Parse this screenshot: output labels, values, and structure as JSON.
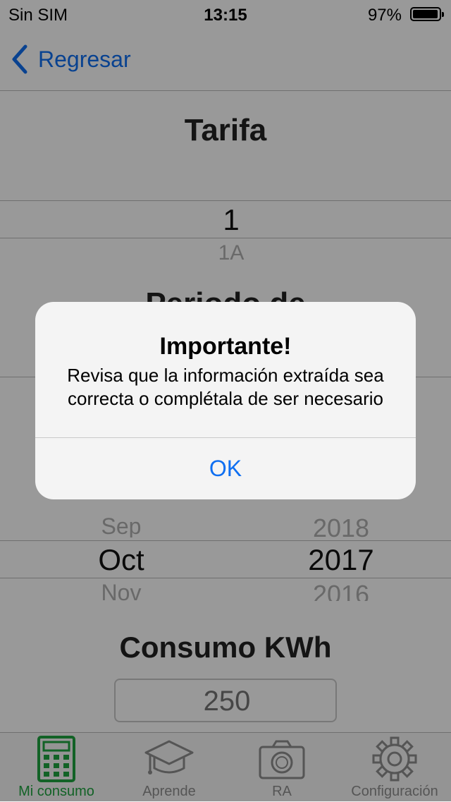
{
  "status_bar": {
    "carrier": "Sin SIM",
    "time": "13:15",
    "battery": "97%",
    "battery_level": 0.97
  },
  "nav": {
    "back_label": "Regresar"
  },
  "tarifa": {
    "title": "Tarifa",
    "selected": "1",
    "next": "1A"
  },
  "periodo": {
    "title_partial": "Periodo de"
  },
  "date_picker": {
    "month_prev": "Sep",
    "month_selected": "Oct",
    "month_next": "Nov",
    "year_prev": "2018",
    "year_selected": "2017",
    "year_next": "2016"
  },
  "consumo": {
    "title": "Consumo KWh",
    "placeholder": "250"
  },
  "tabs": [
    {
      "label": "Mi consumo",
      "icon": "calculator-icon",
      "active": true
    },
    {
      "label": "Aprende",
      "icon": "graduation-cap-icon",
      "active": false
    },
    {
      "label": "RA",
      "icon": "camera-icon",
      "active": false
    },
    {
      "label": "Configuración",
      "icon": "gear-icon",
      "active": false
    }
  ],
  "alert": {
    "title": "Importante!",
    "message": "Revisa que la información extraída sea correcta o complétala de ser necesario",
    "ok_label": "OK"
  },
  "colors": {
    "accent_blue": "#0f6ff1",
    "active_tab_green": "#1fa340",
    "overlay": "rgba(0,0,0,0.40)"
  }
}
